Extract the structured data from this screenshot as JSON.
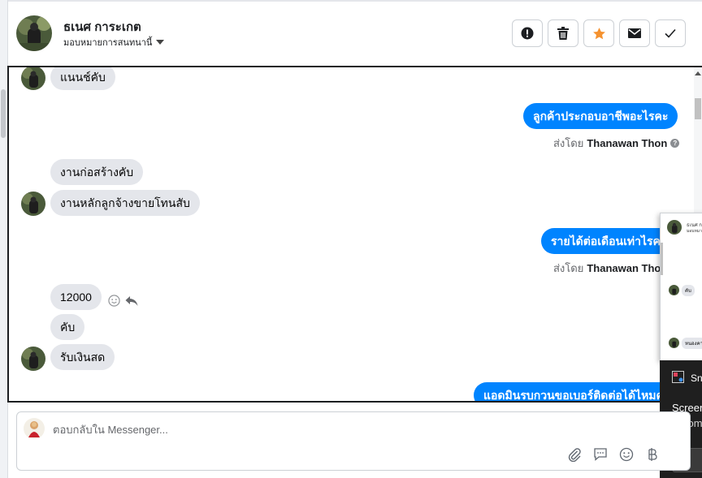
{
  "header": {
    "contact_name": "ธเนศ การะเกต",
    "assign_label": "มอบหมายการสนทนานี้",
    "actions": [
      {
        "name": "spam-button",
        "icon": "alert-icon"
      },
      {
        "name": "delete-button",
        "icon": "trash-icon"
      },
      {
        "name": "star-button",
        "icon": "star-icon"
      },
      {
        "name": "mark-unread-button",
        "icon": "envelope-icon"
      },
      {
        "name": "mark-done-button",
        "icon": "check-icon"
      }
    ]
  },
  "messages": {
    "m1": "แนนช์คับ",
    "m2": "ลูกค้าประกอบอาชีพอะไรคะ",
    "m3": "งานก่อสร้างคับ",
    "m4": "งานหลักลูกจ้างขายโทนสับ",
    "m5": "รายได้ต่อเดือนเท่าไรคะ",
    "m6": "12000",
    "m7": "คับ",
    "m8": "รับเงินสด",
    "m9": "แอดมินรบกวนขอเบอร์ติดต่อได้ไหมคะ"
  },
  "sent_by": {
    "prefix": "ส่งโดย",
    "agent_name": "Thanawan Thon",
    "help_symbol": "?"
  },
  "overlay": {
    "mini_name": "ธเนศ ก",
    "mini_sub": "มอบหมา",
    "mini_msg1": "คับ",
    "mini_msg2": "หนองคา",
    "notif_title": "Sn",
    "notif_line1": "Screen",
    "notif_line2": "Autom"
  },
  "reply": {
    "placeholder": "ตอบกลับใน Messenger..."
  },
  "colors": {
    "outgoing_bubble": "#0084ff",
    "incoming_bubble": "#e4e6eb",
    "star": "#f5922f"
  }
}
